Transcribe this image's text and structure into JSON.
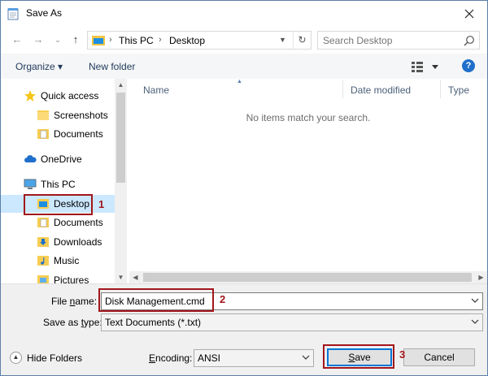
{
  "window": {
    "title": "Save As"
  },
  "address": {
    "crumbs": [
      "This PC",
      "Desktop"
    ],
    "search_placeholder": "Search Desktop"
  },
  "toolbar": {
    "organize": "Organize ▾",
    "new_folder": "New folder",
    "help": "?"
  },
  "nav": {
    "items": [
      {
        "label": "Quick access",
        "icon": "quick-access-star-icon",
        "level": 1
      },
      {
        "label": "Screenshots",
        "icon": "folder-icon",
        "level": 2
      },
      {
        "label": "Documents",
        "icon": "documents-folder-icon",
        "level": 2
      },
      {
        "label": "OneDrive",
        "icon": "onedrive-cloud-icon",
        "level": 1
      },
      {
        "label": "This PC",
        "icon": "computer-icon",
        "level": 1
      },
      {
        "label": "Desktop",
        "icon": "desktop-folder-icon",
        "level": 2,
        "selected": true
      },
      {
        "label": "Documents",
        "icon": "documents-folder-icon",
        "level": 2
      },
      {
        "label": "Downloads",
        "icon": "downloads-folder-icon",
        "level": 2
      },
      {
        "label": "Music",
        "icon": "music-folder-icon",
        "level": 2
      },
      {
        "label": "Pictures",
        "icon": "pictures-folder-icon",
        "level": 2
      }
    ]
  },
  "files": {
    "columns": [
      "Name",
      "Date modified",
      "Type"
    ],
    "empty_message": "No items match your search."
  },
  "form": {
    "filename_label_prefix": "File ",
    "filename_label_accel": "n",
    "filename_label_suffix": "ame:",
    "filename_value": "Disk Management.cmd",
    "savetype_label_prefix": "Save as ",
    "savetype_label_accel": "t",
    "savetype_label_suffix": "ype:",
    "savetype_value": "Text Documents (*.txt)",
    "encoding_label_accel": "E",
    "encoding_label_suffix": "ncoding:",
    "encoding_value": "ANSI"
  },
  "buttons": {
    "hide_folders": "Hide Folders",
    "save_accel": "S",
    "save_rest": "ave",
    "cancel": "Cancel"
  },
  "annotations": [
    "1",
    "2",
    "3"
  ],
  "colors": {
    "accent": "#0078d7",
    "annotation": "#a2161c",
    "selection": "#cce8ff"
  }
}
